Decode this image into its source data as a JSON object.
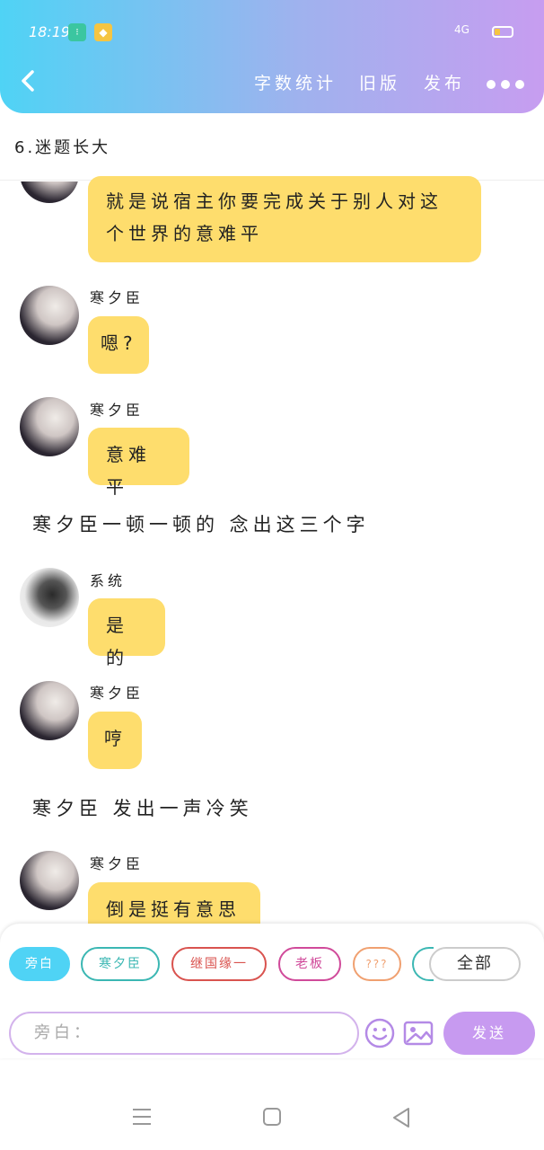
{
  "status": {
    "time": "18:19",
    "network": "4G"
  },
  "header": {
    "nav": [
      "字数统计",
      "旧版",
      "发布"
    ]
  },
  "chapter": {
    "title": "6.迷题长大"
  },
  "messages": {
    "m0": {
      "text_lines": [
        "就是说宿主你要完成关于别人对这",
        "个世界的意难平"
      ]
    },
    "m1": {
      "speaker": "寒夕臣",
      "text": "嗯?"
    },
    "m2": {
      "speaker": "寒夕臣",
      "text": "意难平"
    },
    "n1": {
      "text": "寒夕臣一顿一顿的 念出这三个字"
    },
    "m3": {
      "speaker": "系统",
      "text": "是的"
    },
    "m4": {
      "speaker": "寒夕臣",
      "text": "哼"
    },
    "n2": {
      "text": "寒夕臣 发出一声冷笑"
    },
    "m5": {
      "speaker": "寒夕臣",
      "text": "倒是挺有意思"
    }
  },
  "roles": [
    "旁白",
    "寒夕臣",
    "继国缘一",
    "老板",
    "???",
    "全部"
  ],
  "role_colors": {
    "travel": "#4fd3f5",
    "han": "#3bb7b3",
    "jiguo": "#d9534f",
    "laoban": "#d04a9a",
    "qqq": "#f0a070",
    "all": "#cccccc"
  },
  "composer": {
    "placeholder": "旁白：",
    "send_label": "发送"
  }
}
